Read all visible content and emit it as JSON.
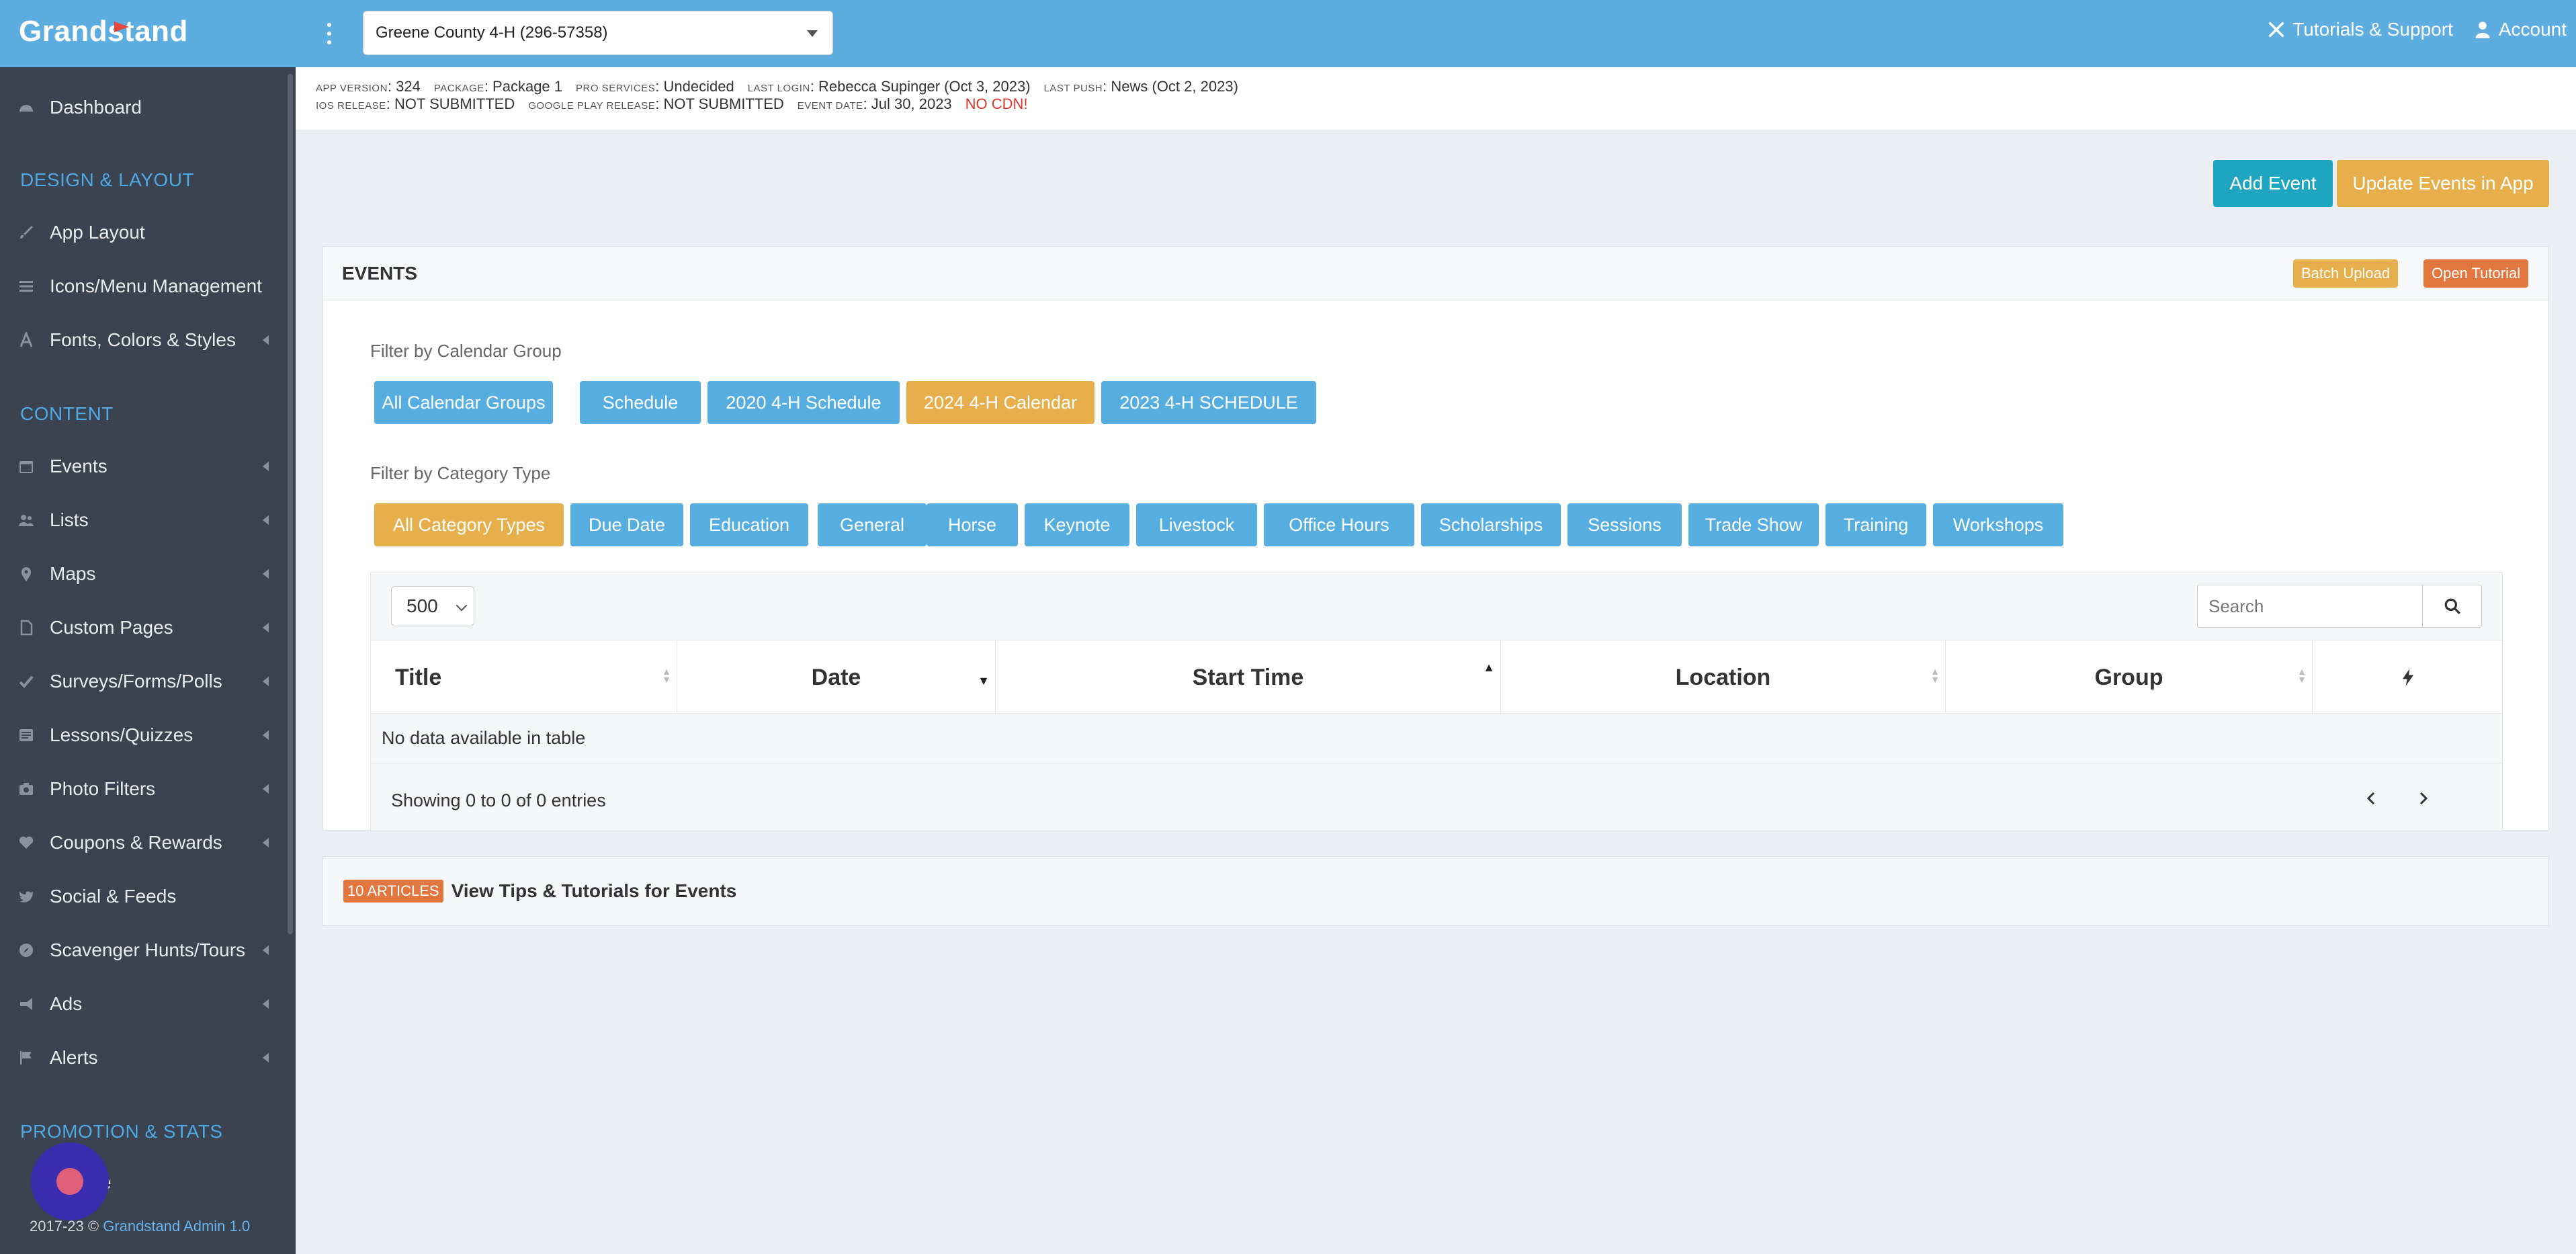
{
  "brand": {
    "logo_text": "Grandstand"
  },
  "topbar": {
    "app_selector_value": "Greene County 4-H (296-57358)",
    "tutorials_label": "Tutorials & Support",
    "account_label": "Account"
  },
  "info": {
    "row1": [
      {
        "key": "App Version",
        "value": "324"
      },
      {
        "key": "Package",
        "value": "Package 1"
      },
      {
        "key": "Pro Services",
        "value": "Undecided"
      },
      {
        "key": "Last Login",
        "value": "Rebecca Supinger (Oct 3, 2023)"
      },
      {
        "key": "Last Push",
        "value": "News (Oct 2, 2023)"
      }
    ],
    "row2": [
      {
        "key": "iOS Release",
        "value": "NOT SUBMITTED"
      },
      {
        "key": "Google Play Release",
        "value": "NOT SUBMITTED"
      },
      {
        "key": "Event Date",
        "value": "Jul 30, 2023"
      }
    ],
    "no_cdn": "NO CDN!"
  },
  "sidebar": {
    "dashboard": "Dashboard",
    "section_design": "DESIGN & LAYOUT",
    "app_layout": "App Layout",
    "icons_menu": "Icons/Menu Management",
    "fonts_colors": "Fonts, Colors & Styles",
    "section_content": "CONTENT",
    "events": "Events",
    "lists": "Lists",
    "maps": "Maps",
    "custom_pages": "Custom Pages",
    "surveys": "Surveys/Forms/Polls",
    "lessons": "Lessons/Quizzes",
    "photo_filters": "Photo Filters",
    "coupons": "Coupons & Rewards",
    "social": "Social & Feeds",
    "scavenger": "Scavenger Hunts/Tours",
    "ads": "Ads",
    "alerts": "Alerts",
    "section_promotion": "PROMOTION & STATS",
    "partial_item": "ce",
    "footer_prefix": "2017-23 © ",
    "footer_link": "Grandstand Admin 1.0"
  },
  "actions": {
    "add_event": "Add Event",
    "update_events": "Update Events in App"
  },
  "panel": {
    "title": "EVENTS",
    "batch_upload": "Batch Upload",
    "open_tutorial": "Open Tutorial",
    "calendar_filter_label": "Filter by Calendar Group",
    "calendar_groups": [
      "All Calendar Groups",
      "Schedule",
      "2020 4-H Schedule",
      "2024 4-H Calendar",
      "2023 4-H SCHEDULE"
    ],
    "category_filter_label": "Filter by Category Type",
    "category_types": [
      "All Category Types",
      "Due Date",
      "Education",
      "General",
      "Horse",
      "Keynote",
      "Livestock",
      "Office Hours",
      "Scholarships",
      "Sessions",
      "Trade Show",
      "Training",
      "Workshops"
    ]
  },
  "table": {
    "page_length": "500",
    "search_placeholder": "Search",
    "columns": [
      "Title",
      "Date",
      "Start Time",
      "Location",
      "Group"
    ],
    "empty_message": "No data available in table",
    "info": "Showing 0 to 0 of 0 entries"
  },
  "articles": {
    "badge": "10 ARTICLES",
    "text": "View Tips & Tutorials for Events"
  },
  "colors": {
    "topbar": "#5eade0",
    "sidebar": "#3b4250",
    "primary_button": "#56aee0",
    "active_filter": "#e6af4b",
    "teal_button": "#1fa5bf",
    "alert_orange": "#e2763f"
  }
}
